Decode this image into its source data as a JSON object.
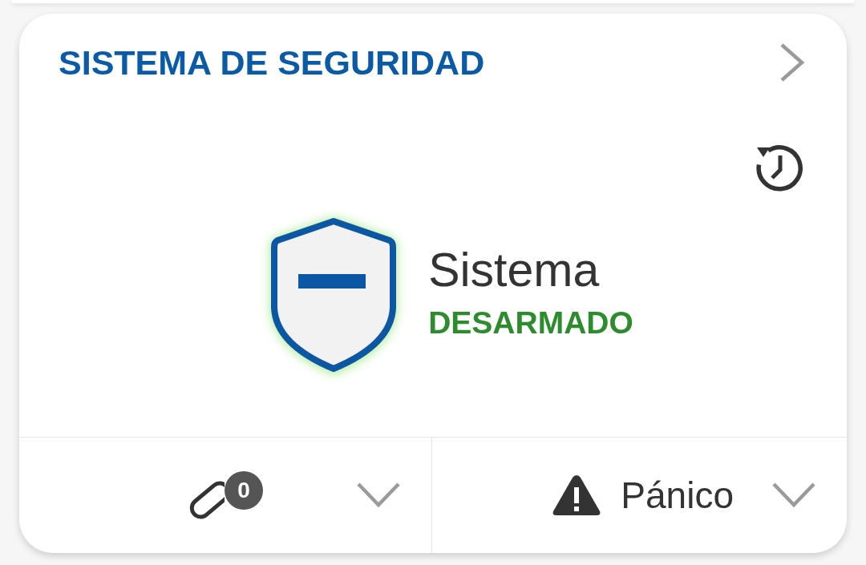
{
  "card": {
    "title": "SISTEMA DE SEGURIDAD",
    "status": {
      "label": "Sistema",
      "state": "DESARMADO",
      "armed": false
    },
    "footer": {
      "sensors": {
        "badge": "0",
        "expanded": false
      },
      "panic": {
        "label": "Pánico",
        "expanded": false
      }
    }
  }
}
